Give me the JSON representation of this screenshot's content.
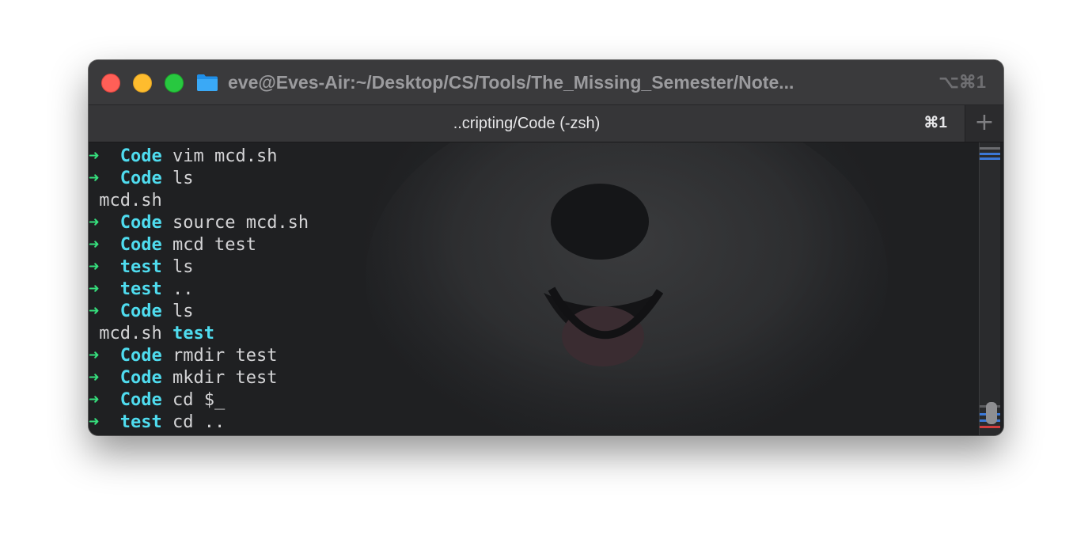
{
  "window": {
    "title": "eve@Eves-Air:~/Desktop/CS/Tools/The_Missing_Semester/Note...",
    "shortcut": "⌥⌘1"
  },
  "tab": {
    "title": "..cripting/Code (-zsh)",
    "shortcut": "⌘1",
    "new_tab_label": "+"
  },
  "terminal": {
    "lines": [
      {
        "type": "prompt",
        "dir": "Code",
        "cmd": "vim mcd.sh"
      },
      {
        "type": "prompt",
        "dir": "Code",
        "cmd": "ls"
      },
      {
        "type": "output",
        "text": "mcd.sh"
      },
      {
        "type": "prompt",
        "dir": "Code",
        "cmd": "source mcd.sh"
      },
      {
        "type": "prompt",
        "dir": "Code",
        "cmd": "mcd test"
      },
      {
        "type": "prompt",
        "dir": "test",
        "cmd": "ls"
      },
      {
        "type": "prompt",
        "dir": "test",
        "cmd": ".."
      },
      {
        "type": "prompt",
        "dir": "Code",
        "cmd": "ls"
      },
      {
        "type": "output",
        "text": "mcd.sh",
        "dir_text": "test"
      },
      {
        "type": "prompt",
        "dir": "Code",
        "cmd": "rmdir test"
      },
      {
        "type": "prompt",
        "dir": "Code",
        "cmd": "mkdir test"
      },
      {
        "type": "prompt",
        "dir": "Code",
        "cmd": "cd $_"
      },
      {
        "type": "prompt",
        "dir": "test",
        "cmd": "cd .."
      }
    ],
    "prompt_symbol": "➜"
  },
  "colors": {
    "prompt_arrow": "#36e07d",
    "directory": "#4fdcef",
    "text": "#d4d4d6",
    "background": "#1f2022"
  },
  "icons": {
    "folder": "folder-icon",
    "new_tab": "plus-icon"
  }
}
